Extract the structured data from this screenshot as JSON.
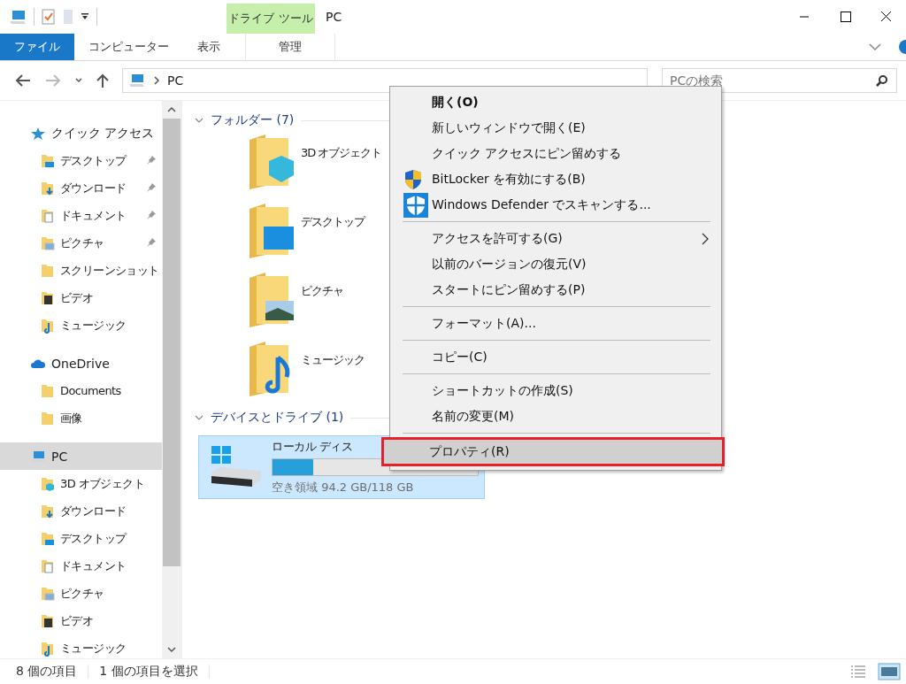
{
  "window": {
    "title": "PC",
    "context_tab_group": "ドライブ ツール"
  },
  "ribbon_tabs": [
    {
      "label": "ファイル",
      "kind": "file",
      "selected": false
    },
    {
      "label": "コンピューター",
      "kind": "tab",
      "selected": false
    },
    {
      "label": "表示",
      "kind": "tab",
      "selected": false
    },
    {
      "label": "管理",
      "kind": "context",
      "selected": false
    }
  ],
  "address": {
    "path": "PC",
    "search_placeholder": "PCの検索"
  },
  "sidebar": {
    "sections": [
      {
        "label": "クイック アクセス",
        "kind": "star",
        "selected": false,
        "children": [
          {
            "label": "デスクトップ",
            "kind": "desktop",
            "pinned": true
          },
          {
            "label": "ダウンロード",
            "kind": "download",
            "pinned": true
          },
          {
            "label": "ドキュメント",
            "kind": "document",
            "pinned": true
          },
          {
            "label": "ピクチャ",
            "kind": "picture",
            "pinned": true
          },
          {
            "label": "スクリーンショット",
            "kind": "folder",
            "pinned": false
          },
          {
            "label": "ビデオ",
            "kind": "video",
            "pinned": false
          },
          {
            "label": "ミュージック",
            "kind": "music",
            "pinned": false
          }
        ]
      },
      {
        "label": "OneDrive",
        "kind": "cloud",
        "selected": false,
        "children": [
          {
            "label": "Documents",
            "kind": "folder",
            "pinned": false
          },
          {
            "label": "画像",
            "kind": "folder",
            "pinned": false
          }
        ]
      },
      {
        "label": "PC",
        "kind": "pc",
        "selected": true,
        "children": [
          {
            "label": "3D オブジェクト",
            "kind": "cube",
            "pinned": false
          },
          {
            "label": "ダウンロード",
            "kind": "download",
            "pinned": false
          },
          {
            "label": "デスクトップ",
            "kind": "desktop",
            "pinned": false
          },
          {
            "label": "ドキュメント",
            "kind": "document",
            "pinned": false
          },
          {
            "label": "ピクチャ",
            "kind": "picture",
            "pinned": false
          },
          {
            "label": "ビデオ",
            "kind": "video",
            "pinned": false
          },
          {
            "label": "ミュージック",
            "kind": "music",
            "pinned": false
          }
        ]
      }
    ]
  },
  "groups": [
    {
      "title": "フォルダー (7)",
      "items": [
        {
          "name": "3D オブジェクト",
          "kind": "cube"
        },
        {
          "name": "デスクトップ",
          "kind": "desktop"
        },
        {
          "name": "ピクチャ",
          "kind": "picture"
        },
        {
          "name": "ミュージック",
          "kind": "music"
        }
      ]
    },
    {
      "title": "デバイスとドライブ (1)",
      "drives": [
        {
          "name": "ローカル ディス",
          "level": 0.2,
          "free": "空き領域 94.2 GB/118 GB",
          "selected": true
        }
      ]
    }
  ],
  "context_menu": {
    "groups": [
      [
        {
          "label": "開く(O)",
          "default": true,
          "kind": "plain",
          "submenu": false,
          "selected": false,
          "outlined": false
        },
        {
          "label": "新しいウィンドウで開く(E)",
          "default": false,
          "kind": "plain",
          "submenu": false,
          "selected": false,
          "outlined": false
        },
        {
          "label": "クイック アクセスにピン留めする",
          "default": false,
          "kind": "plain",
          "submenu": false,
          "selected": false,
          "outlined": false
        },
        {
          "label": "BitLocker を有効にする(B)",
          "default": false,
          "kind": "uac",
          "submenu": false,
          "selected": false,
          "outlined": false
        },
        {
          "label": "Windows Defender でスキャンする...",
          "default": false,
          "kind": "defender",
          "submenu": false,
          "selected": false,
          "outlined": false
        }
      ],
      [
        {
          "label": "アクセスを許可する(G)",
          "default": false,
          "kind": "plain",
          "submenu": true,
          "selected": false,
          "outlined": false
        },
        {
          "label": "以前のバージョンの復元(V)",
          "default": false,
          "kind": "plain",
          "submenu": false,
          "selected": false,
          "outlined": false
        },
        {
          "label": "スタートにピン留めする(P)",
          "default": false,
          "kind": "plain",
          "submenu": false,
          "selected": false,
          "outlined": false
        }
      ],
      [
        {
          "label": "フォーマット(A)...",
          "default": false,
          "kind": "plain",
          "submenu": false,
          "selected": false,
          "outlined": false
        }
      ],
      [
        {
          "label": "コピー(C)",
          "default": false,
          "kind": "plain",
          "submenu": false,
          "selected": false,
          "outlined": false
        }
      ],
      [
        {
          "label": "ショートカットの作成(S)",
          "default": false,
          "kind": "plain",
          "submenu": false,
          "selected": false,
          "outlined": false
        },
        {
          "label": "名前の変更(M)",
          "default": false,
          "kind": "plain",
          "submenu": false,
          "selected": false,
          "outlined": false
        }
      ],
      [
        {
          "label": "プロパティ(R)",
          "default": false,
          "kind": "plain",
          "submenu": false,
          "selected": true,
          "outlined": true
        }
      ]
    ]
  },
  "status_bar": {
    "item_count": "8 個の項目",
    "selection": "1 個の項目を選択"
  }
}
